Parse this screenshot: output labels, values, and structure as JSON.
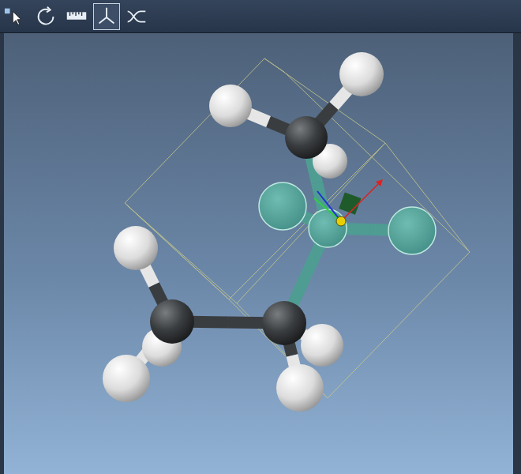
{
  "toolbar": {
    "tools": [
      {
        "name": "select",
        "selected": false
      },
      {
        "name": "rotate",
        "selected": false
      },
      {
        "name": "measure",
        "selected": false
      },
      {
        "name": "manipulate",
        "selected": true
      },
      {
        "name": "bond-rotate",
        "selected": false
      }
    ]
  },
  "molecule": {
    "atoms": [
      {
        "kind": "hydrogen",
        "selected": false
      },
      {
        "kind": "hydrogen",
        "selected": false
      },
      {
        "kind": "carbon",
        "selected": false
      },
      {
        "kind": "hydrogen",
        "selected": false
      },
      {
        "kind": "hydrogen",
        "selected": false
      },
      {
        "kind": "carbon",
        "selected": false
      },
      {
        "kind": "hydrogen",
        "selected": false
      },
      {
        "kind": "hydrogen",
        "selected": false
      },
      {
        "kind": "carbon",
        "selected": false
      },
      {
        "kind": "hydrogen",
        "selected": false
      },
      {
        "kind": "hydrogen",
        "selected": false
      },
      {
        "kind": "carbon",
        "selected": true
      },
      {
        "kind": "fluorine",
        "selected": true
      },
      {
        "kind": "fluorine",
        "selected": true
      }
    ]
  }
}
